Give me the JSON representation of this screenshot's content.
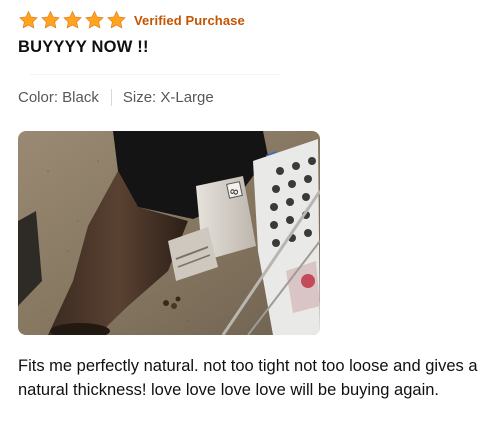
{
  "review": {
    "rating": 5,
    "rating_max": 5,
    "star_color": "#ffa41c",
    "star_icon": "star-icon",
    "verified_label": "Verified Purchase",
    "verified_color": "#c45500",
    "title": "BUYYYY NOW !!",
    "variant": {
      "color_label": "Color: Black",
      "size_label": "Size: X-Large"
    },
    "photo": {
      "icon": "review-photo"
    },
    "body": "Fits me perfectly natural. not too tight not too loose and gives a natural thickness! love love love love will be buying again."
  }
}
